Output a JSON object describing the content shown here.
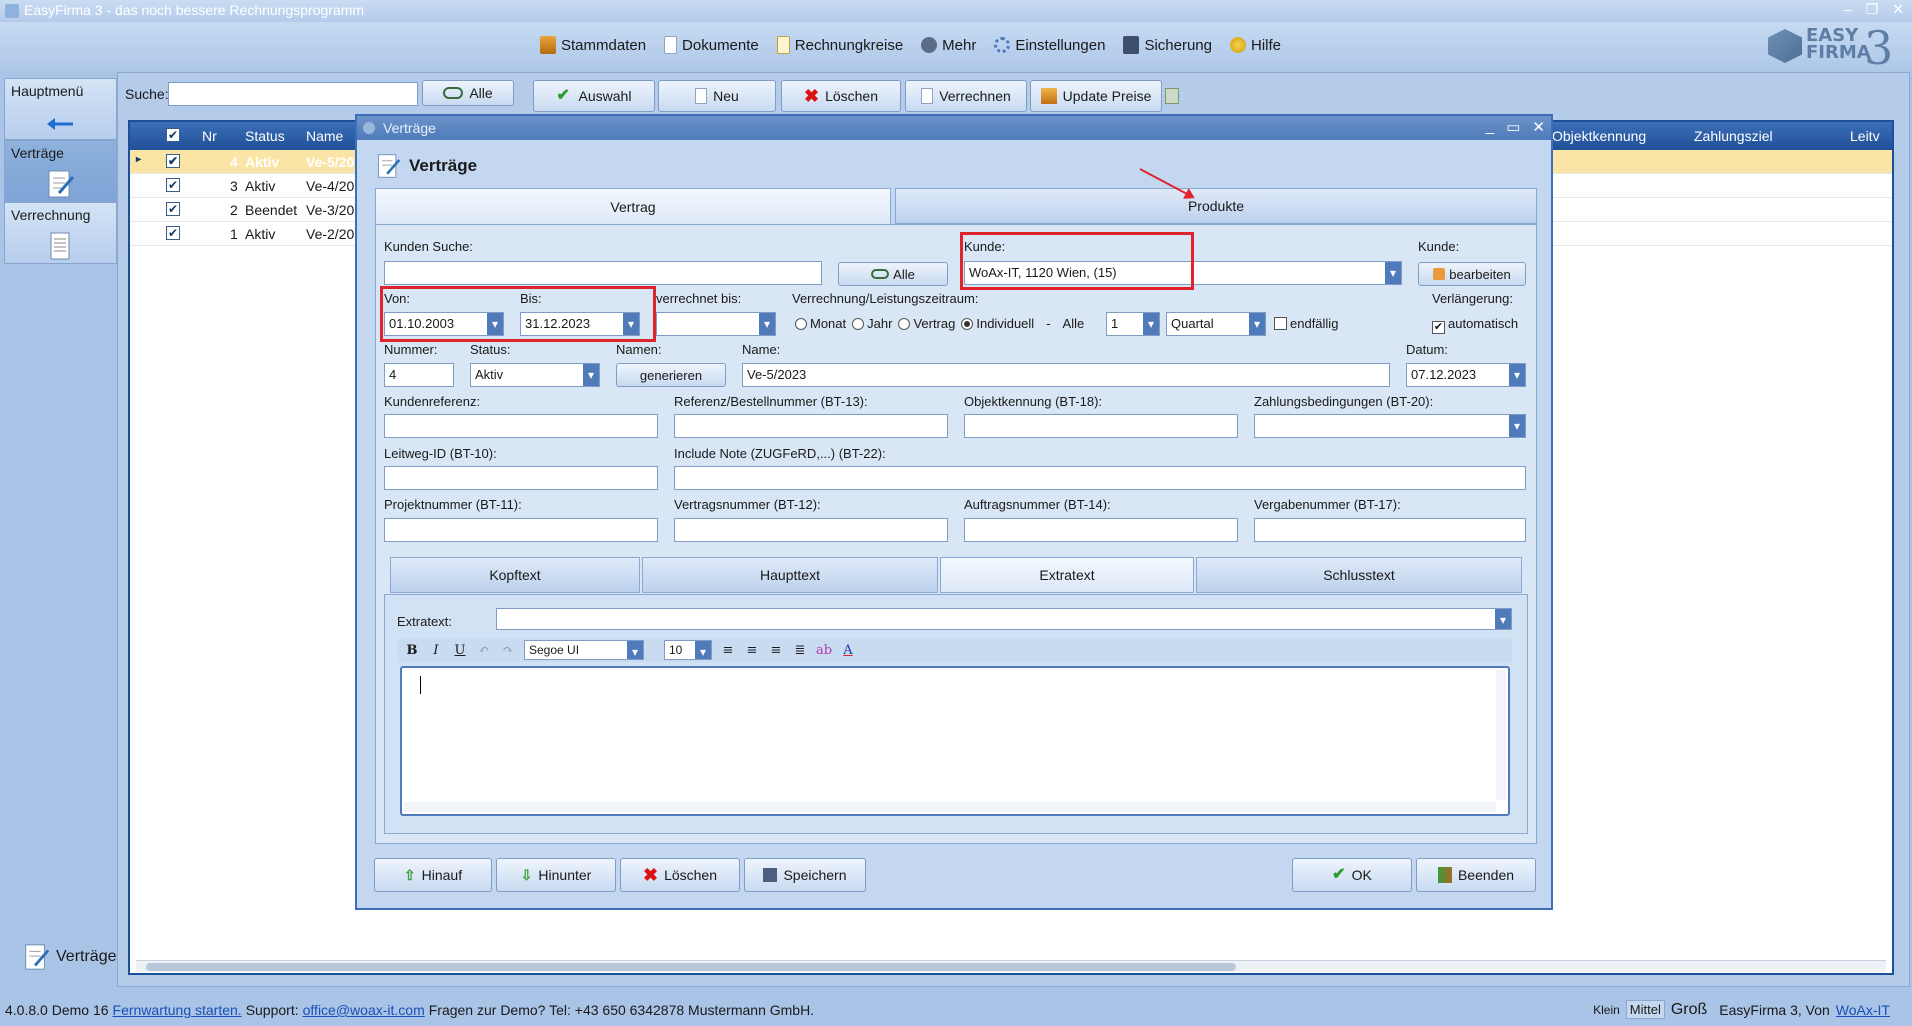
{
  "window": {
    "title": "EasyFirma 3 - das noch bessere Rechnungsprogramm",
    "controls": [
      "–",
      "❐",
      "✕"
    ]
  },
  "menu": {
    "items": [
      {
        "label": "Stammdaten",
        "icon": "database-icon"
      },
      {
        "label": "Dokumente",
        "icon": "document-icon"
      },
      {
        "label": "Rechnungkreise",
        "icon": "circle-document-icon"
      },
      {
        "label": "Mehr",
        "icon": "more-icon"
      },
      {
        "label": "Einstellungen",
        "icon": "gear-icon"
      },
      {
        "label": "Sicherung",
        "icon": "backup-icon"
      },
      {
        "label": "Hilfe",
        "icon": "help-icon"
      }
    ],
    "logo_line1": "EASY",
    "logo_line2": "FIRMA",
    "logo_num": "3"
  },
  "sidebar": {
    "items": [
      {
        "label": "Hauptmenü"
      },
      {
        "label": "Verträge"
      },
      {
        "label": "Verrechnung"
      }
    ],
    "bottom_label": "Verträge"
  },
  "toolbar": {
    "search_label": "Suche:",
    "search_value": "",
    "alle": "Alle",
    "auswahl": "Auswahl",
    "neu": "Neu",
    "loeschen": "Löschen",
    "verrechnen": "Verrechnen",
    "update_preise": "Update Preise"
  },
  "grid": {
    "headers": {
      "nr": "Nr",
      "status": "Status",
      "name": "Name",
      "objekt": "Objektkennung",
      "ziel": "Zahlungsziel",
      "leit": "Leitv"
    },
    "rows": [
      {
        "nr": "4",
        "status": "Aktiv",
        "name": "Ve-5/20"
      },
      {
        "nr": "3",
        "status": "Aktiv",
        "name": "Ve-4/20"
      },
      {
        "nr": "2",
        "status": "Beendet",
        "name": "Ve-3/20"
      },
      {
        "nr": "1",
        "status": "Aktiv",
        "name": "Ve-2/20"
      }
    ]
  },
  "dialog": {
    "title": "Verträge",
    "header": "Verträge",
    "tabs": [
      "Vertrag",
      "Produkte"
    ],
    "kunden_suche_label": "Kunden Suche:",
    "kunden_suche_value": "",
    "alle_btn": "Alle",
    "kunde_label": "Kunde:",
    "kunde_value": "WoAx-IT, 1120 Wien, (15)",
    "kunde2_label": "Kunde:",
    "bearbeiten": "bearbeiten",
    "von_label": "Von:",
    "von_value": "01.10.2003",
    "bis_label": "Bis:",
    "bis_value": "31.12.2023",
    "verrechnet_label": "verrechnet bis:",
    "verrechnet_value": "",
    "zeitraum_label": "Verrechnung/Leistungszeitraum:",
    "radio_monat": "Monat",
    "radio_jahr": "Jahr",
    "radio_vertrag": "Vertrag",
    "radio_individuell": "Individuell",
    "alle_sep": "-",
    "alle_label": "Alle",
    "alle_value": "1",
    "period_value": "Quartal",
    "endfaellig": "endfällig",
    "verlaengerung_label": "Verlängerung:",
    "automatisch": "automatisch",
    "nummer_label": "Nummer:",
    "nummer_value": "4",
    "status_label": "Status:",
    "status_value": "Aktiv",
    "namen_label": "Namen:",
    "generieren": "generieren",
    "name_label": "Name:",
    "name_value": "Ve-5/2023",
    "datum_label": "Datum:",
    "datum_value": "07.12.2023",
    "kundenreferenz_label": "Kundenreferenz:",
    "referenz_label": "Referenz/Bestellnummer (BT-13):",
    "objektkennung_label": "Objektkennung (BT-18):",
    "zahlungsbed_label": "Zahlungsbedingungen (BT-20):",
    "leitweg_label": "Leitweg-ID (BT-10):",
    "include_label": "Include Note (ZUGFeRD,...) (BT-22):",
    "projekt_label": "Projektnummer (BT-11):",
    "vertragsnr_label": "Vertragsnummer (BT-12):",
    "auftragsnr_label": "Auftragsnummer (BT-14):",
    "vergabenr_label": "Vergabenummer (BT-17):",
    "subtabs": [
      "Kopftext",
      "Haupttext",
      "Extratext",
      "Schlusstext"
    ],
    "extratext_label": "Extratext:",
    "font_value": "Segoe UI",
    "size_value": "10",
    "footer": {
      "hinauf": "Hinauf",
      "hinunter": "Hinunter",
      "loeschen": "Löschen",
      "speichern": "Speichern",
      "ok": "OK",
      "beenden": "Beenden"
    }
  },
  "status": {
    "version": "4.0.8.0 Demo 16",
    "fernwartung": "Fernwartung starten.",
    "support_label": "Support:",
    "email": "office@woax-it.com",
    "demo_text": "Fragen zur Demo? Tel: +43 650 6342878 Mustermann GmbH.",
    "klein": "Klein",
    "mittel": "Mittel",
    "gross": "Groß",
    "product": "EasyFirma 3, Von",
    "vendor": "WoAx-IT"
  }
}
